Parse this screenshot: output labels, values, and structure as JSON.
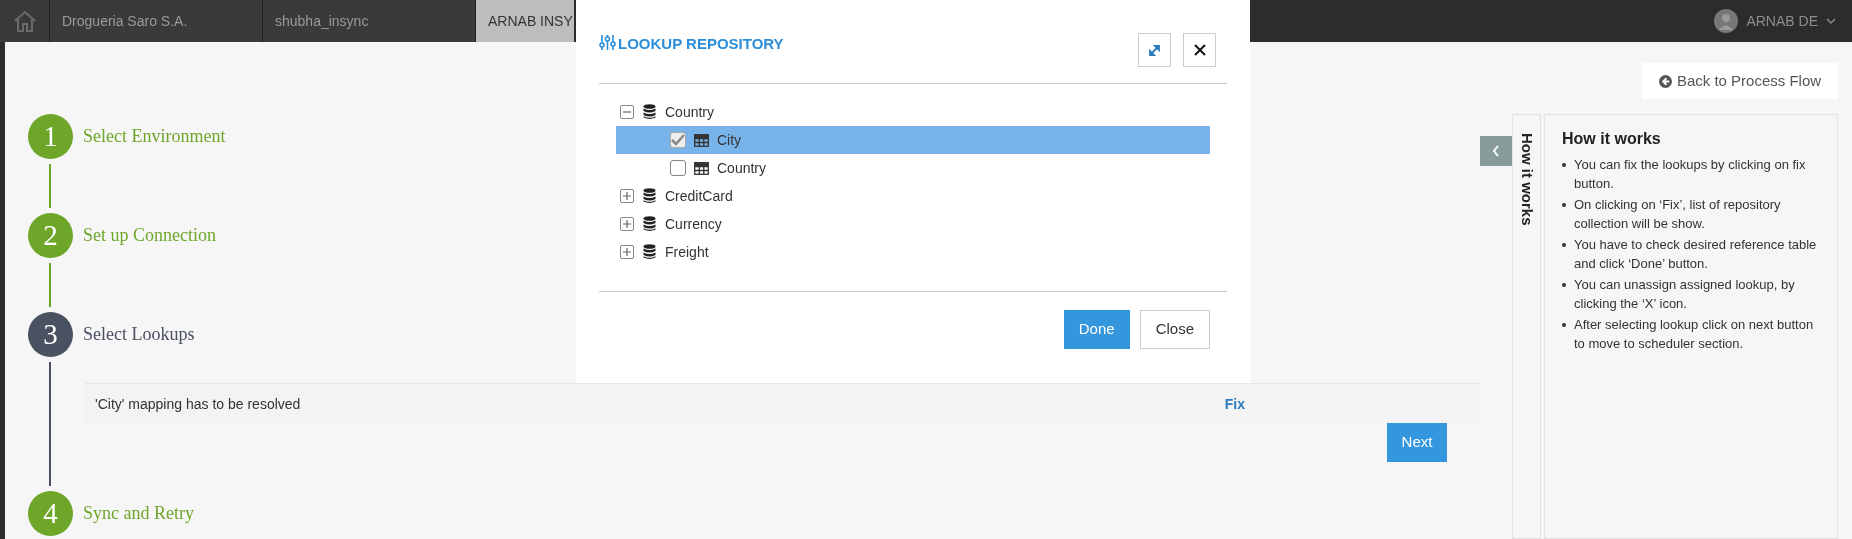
{
  "top_bar": {
    "tabs": [
      {
        "label": "Drogueria Saro S.A.",
        "selected": false
      },
      {
        "label": "shubha_insync",
        "selected": false
      },
      {
        "label": "ARNAB INSY",
        "selected": true
      }
    ],
    "user": "ARNAB DE"
  },
  "steps": [
    {
      "number": "1",
      "label": "Select Environment",
      "current": false
    },
    {
      "number": "2",
      "label": "Set up Connection",
      "current": false
    },
    {
      "number": "3",
      "label": "Select Lookups",
      "current": true
    },
    {
      "number": "4",
      "label": "Sync and Retry",
      "current": false
    }
  ],
  "message": {
    "text": "'City' mapping has to be resolved",
    "action": "Fix"
  },
  "next_button": "Next",
  "back_button": "Back to Process Flow",
  "help": {
    "tab_label": "How it works",
    "title": "How it works",
    "items": [
      "You can fix the lookups by clicking on fix button.",
      "On clicking on ‘Fix’, list of repository collection will be show.",
      "You have to check desired reference table and click ‘Done’ button.",
      "You can unassign assigned lookup, by clicking the ‘X’ icon.",
      "After selecting lookup click on next button to move to scheduler section."
    ]
  },
  "modal": {
    "title": "LOOKUP REPOSITORY",
    "tree": [
      {
        "label": "Country",
        "expanded": true,
        "children": [
          {
            "label": "City",
            "checked": true,
            "selected": true
          },
          {
            "label": "Country",
            "checked": false,
            "selected": false
          }
        ]
      },
      {
        "label": "CreditCard",
        "expanded": false
      },
      {
        "label": "Currency",
        "expanded": false
      },
      {
        "label": "Freight",
        "expanded": false
      }
    ],
    "buttons": [
      {
        "label": "Done",
        "kind": "primary"
      },
      {
        "label": "Close",
        "kind": "secondary"
      }
    ]
  }
}
